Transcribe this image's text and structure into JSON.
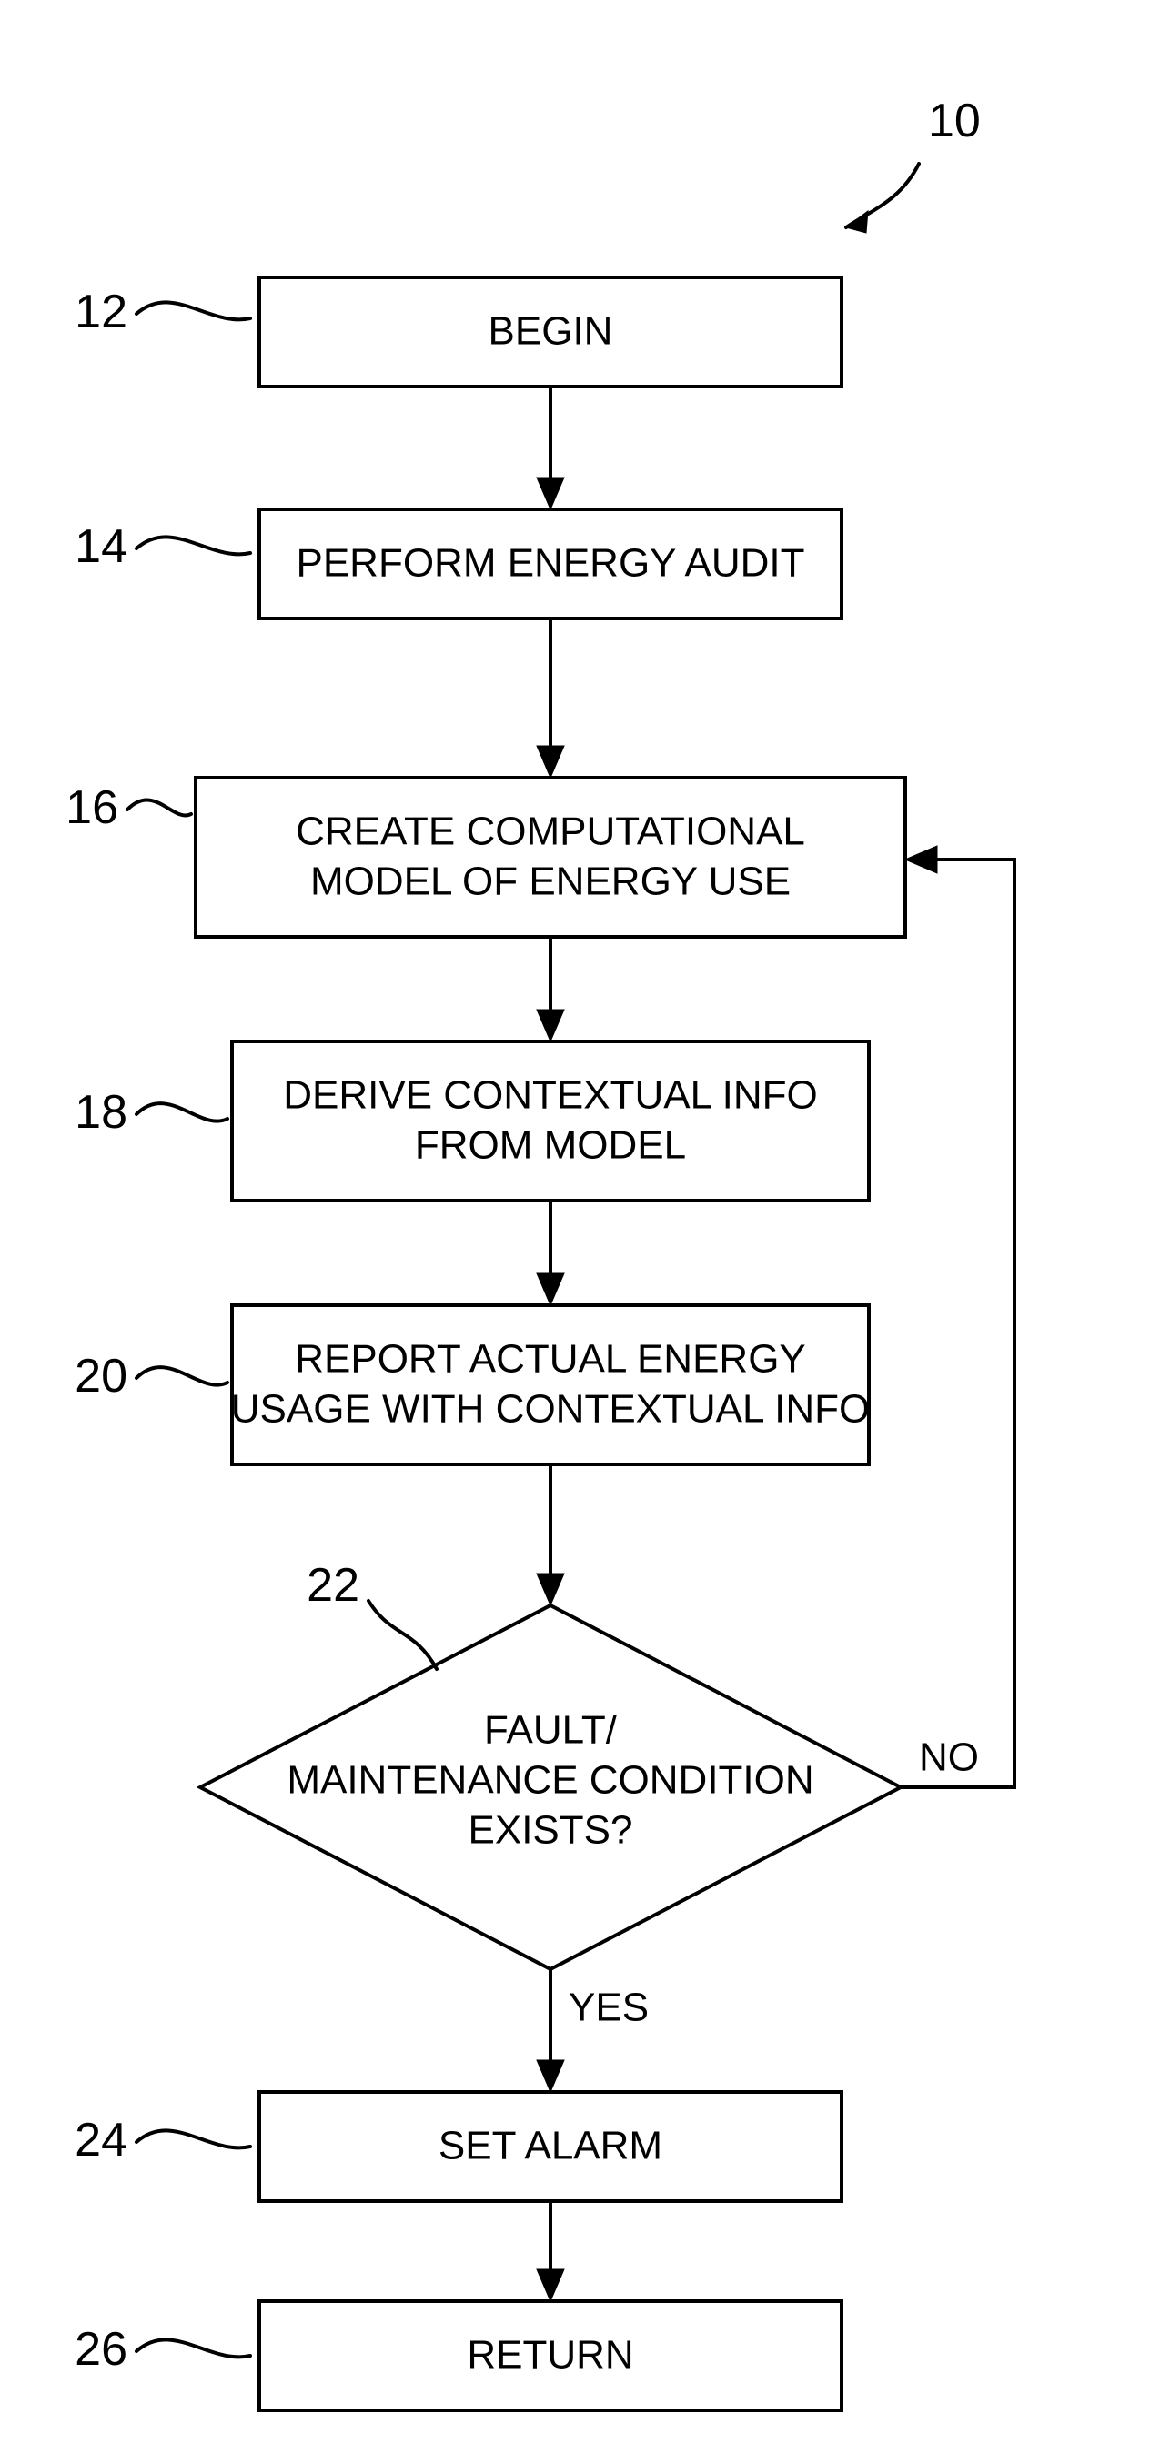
{
  "figure_ref": "10",
  "nodes": {
    "n12": {
      "ref": "12",
      "line1": "BEGIN"
    },
    "n14": {
      "ref": "14",
      "line1": "PERFORM ENERGY AUDIT"
    },
    "n16": {
      "ref": "16",
      "line1": "CREATE COMPUTATIONAL",
      "line2": "MODEL OF ENERGY USE"
    },
    "n18": {
      "ref": "18",
      "line1": "DERIVE CONTEXTUAL INFO",
      "line2": "FROM MODEL"
    },
    "n20": {
      "ref": "20",
      "line1": "REPORT ACTUAL ENERGY",
      "line2": "USAGE WITH CONTEXTUAL INFO"
    },
    "n22": {
      "ref": "22",
      "line1": "FAULT/",
      "line2": "MAINTENANCE CONDITION",
      "line3": "EXISTS?"
    },
    "n24": {
      "ref": "24",
      "line1": "SET ALARM"
    },
    "n26": {
      "ref": "26",
      "line1": "RETURN"
    }
  },
  "edges": {
    "yes": "YES",
    "no": "NO"
  }
}
